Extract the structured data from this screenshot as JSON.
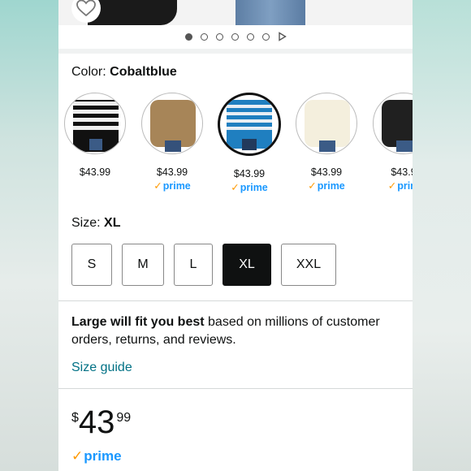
{
  "color": {
    "label": "Color:",
    "value": "Cobaltblue"
  },
  "swatches": [
    {
      "name": "black-white-stripe",
      "price": "$43.99",
      "prime": ""
    },
    {
      "name": "camel",
      "price": "$43.99",
      "prime": "prime"
    },
    {
      "name": "cobaltblue",
      "price": "$43.99",
      "prime": "prime",
      "selected": true
    },
    {
      "name": "cream",
      "price": "$43.99",
      "prime": "prime"
    },
    {
      "name": "black",
      "price": "$43.9",
      "prime": "prim"
    }
  ],
  "size": {
    "label": "Size:",
    "value": "XL",
    "options": [
      "S",
      "M",
      "L",
      "XL",
      "XXL"
    ]
  },
  "fit": {
    "bold": "Large will fit you best",
    "rest": " based on millions of customer orders, returns, and reviews."
  },
  "size_guide": "Size guide",
  "price": {
    "symbol": "$",
    "whole": "43",
    "fraction": "99"
  },
  "prime_label": "prime",
  "check_glyph": "✓",
  "colors": {
    "accent_link": "#007185",
    "prime_blue": "#1a98ff",
    "prime_check": "#ff9900",
    "selected": "#0f1111"
  }
}
